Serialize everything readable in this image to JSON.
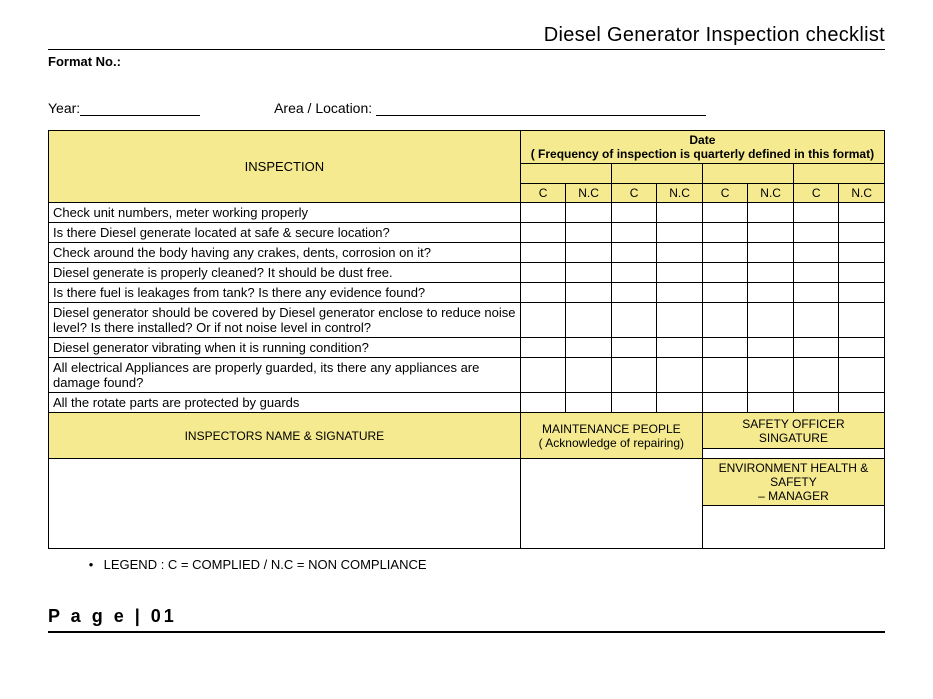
{
  "title": "Diesel Generator Inspection checklist",
  "format_no_label": "Format No.:",
  "year_label": "Year:",
  "area_label": "Area / Location:",
  "table": {
    "inspection_header": "INSPECTION",
    "date_header": "Date",
    "date_sub": "( Frequency of inspection is quarterly defined in this format)",
    "c_label": "C",
    "nc_label": "N.C",
    "rows": [
      "Check unit numbers, meter working properly",
      "Is there Diesel generate located at safe & secure location?",
      "Check around the body having any crakes, dents, corrosion on it?",
      "Diesel generate is properly cleaned? It should be dust free.",
      "Is there fuel is leakages from tank? Is there any evidence found?",
      "Diesel generator should be covered by Diesel generator enclose to reduce noise level? Is there installed? Or if not noise level in control?",
      "Diesel generator vibrating when it is running condition?",
      "All electrical Appliances are properly guarded, its there any appliances are damage found?",
      "All the rotate parts are protected by guards"
    ]
  },
  "signatures": {
    "inspector": "INSPECTORS NAME &  SIGNATURE",
    "maintenance": "MAINTENANCE PEOPLE",
    "maintenance_sub": "( Acknowledge of repairing)",
    "safety": "SAFETY OFFICER SINGATURE",
    "ehs1": "ENVIRONMENT HEALTH & SAFETY",
    "ehs2": "– MANAGER"
  },
  "legend": "LEGEND : C = COMPLIED / N.C = NON COMPLIANCE",
  "page_footer": "P a g e  | 01"
}
